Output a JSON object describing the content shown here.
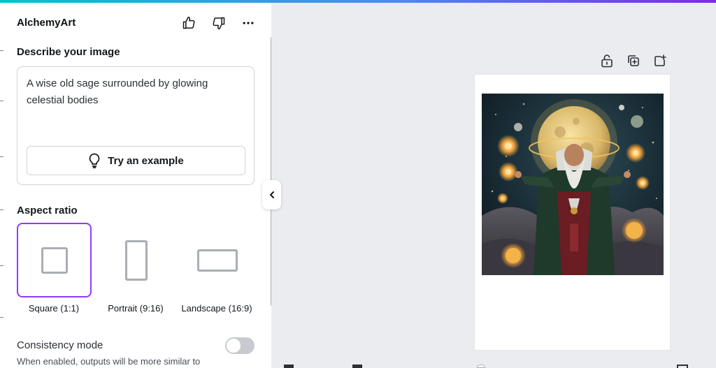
{
  "app": {
    "title": "AlchemyArt"
  },
  "header": {
    "like_icon": "thumbs-up-icon",
    "dislike_icon": "thumbs-down-icon",
    "more_icon": "more-horizontal-icon"
  },
  "describe": {
    "title": "Describe your image",
    "prompt": "A wise old sage surrounded by glowing celestial bodies",
    "example_button": "Try an example",
    "example_icon": "lightbulb-icon"
  },
  "aspect_ratio": {
    "title": "Aspect ratio",
    "options": [
      {
        "label": "Square (1:1)",
        "selected": true
      },
      {
        "label": "Portrait (9:16)",
        "selected": false
      },
      {
        "label": "Landscape (16:9)",
        "selected": false
      }
    ]
  },
  "consistency": {
    "title": "Consistency mode",
    "description": "When enabled, outputs will be more similar to",
    "enabled": false
  },
  "canvas": {
    "tools": [
      "unlock-icon",
      "duplicate-page-icon",
      "add-page-icon"
    ]
  },
  "colors": {
    "accent": "#8b3dff",
    "canvas_bg": "#ebecf0",
    "panel_bg": "#ffffff"
  }
}
